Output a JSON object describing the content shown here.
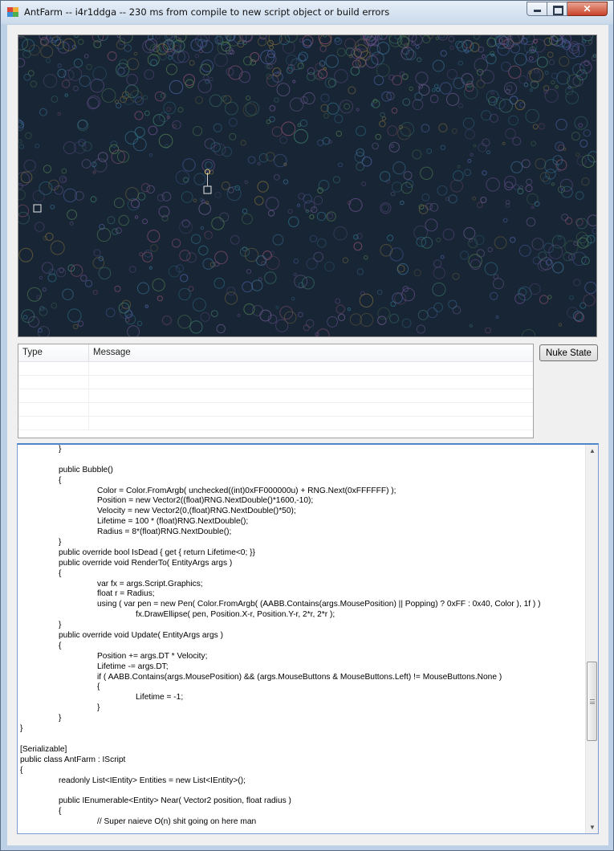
{
  "window": {
    "title": "AntFarm -- i4r1ddga -- 230 ms from compile to new script object or build errors",
    "icon": "application-icon",
    "controls": {
      "minimize": "minimize-icon",
      "maximize": "maximize-icon",
      "close": "close-icon"
    }
  },
  "colors": {
    "canvas_bg": "#172535",
    "editor_border": "#4f86c9"
  },
  "canvas": {
    "description_icon": "render-surface"
  },
  "messages": {
    "columns": [
      "Type",
      "Message"
    ],
    "rows": []
  },
  "buttons": {
    "nuke_state": "Nuke State"
  },
  "editor": {
    "lines": [
      "\t}",
      "",
      "\tpublic Bubble()",
      "\t{",
      "\t\tColor = Color.FromArgb( unchecked((int)0xFF000000u) + RNG.Next(0xFFFFFF) );",
      "\t\tPosition = new Vector2((float)RNG.NextDouble()*1600,-10);",
      "\t\tVelocity = new Vector2(0,(float)RNG.NextDouble()*50);",
      "\t\tLifetime = 100 * (float)RNG.NextDouble();",
      "\t\tRadius = 8*(float)RNG.NextDouble();",
      "\t}",
      "\tpublic override bool IsDead { get { return Lifetime<0; }}",
      "\tpublic override void RenderTo( EntityArgs args )",
      "\t{",
      "\t\tvar fx = args.Script.Graphics;",
      "\t\tfloat r = Radius;",
      "\t\tusing ( var pen = new Pen( Color.FromArgb( (AABB.Contains(args.MousePosition) || Popping) ? 0xFF : 0x40, Color ), 1f ) )",
      "\t\t\tfx.DrawEllipse( pen, Position.X-r, Position.Y-r, 2*r, 2*r );",
      "\t}",
      "\tpublic override void Update( EntityArgs args )",
      "\t{",
      "\t\tPosition += args.DT * Velocity;",
      "\t\tLifetime -= args.DT;",
      "\t\tif ( AABB.Contains(args.MousePosition) && (args.MouseButtons & MouseButtons.Left) != MouseButtons.None )",
      "\t\t{",
      "\t\t\tLifetime = -1;",
      "\t\t}",
      "\t}",
      "}",
      "",
      "[Serializable]",
      "public class AntFarm : IScript",
      "{",
      "\treadonly List<IEntity> Entities = new List<IEntity>();",
      "",
      "\tpublic IEnumerable<Entity> Near( Vector2 position, float radius )",
      "\t{",
      "\t\t// Super naieve O(n) shit going on here man"
    ]
  }
}
